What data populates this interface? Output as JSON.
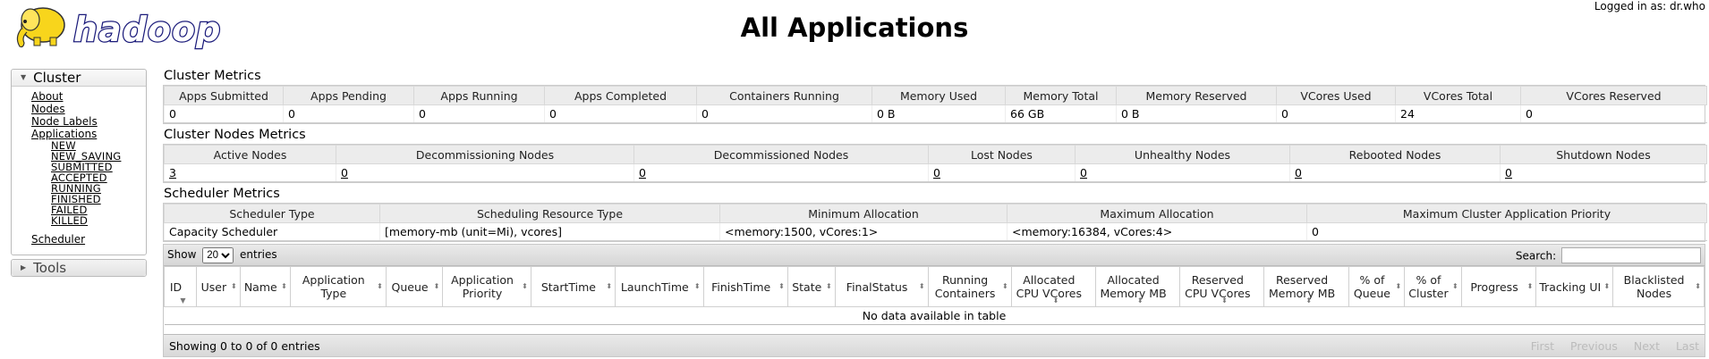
{
  "header": {
    "logo_text": "hadoop",
    "title": "All Applications",
    "login": "Logged in as: dr.who"
  },
  "nav": {
    "cluster_label": "Cluster",
    "cluster_links": [
      "About",
      "Nodes",
      "Node Labels",
      "Applications"
    ],
    "app_states": [
      "NEW",
      "NEW_SAVING",
      "SUBMITTED",
      "ACCEPTED",
      "RUNNING",
      "FINISHED",
      "FAILED",
      "KILLED"
    ],
    "scheduler": "Scheduler",
    "tools_label": "Tools"
  },
  "cluster_metrics": {
    "title": "Cluster Metrics",
    "headers": [
      "Apps Submitted",
      "Apps Pending",
      "Apps Running",
      "Apps Completed",
      "Containers Running",
      "Memory Used",
      "Memory Total",
      "Memory Reserved",
      "VCores Used",
      "VCores Total",
      "VCores Reserved"
    ],
    "values": [
      "0",
      "0",
      "0",
      "0",
      "0",
      "0 B",
      "66 GB",
      "0 B",
      "0",
      "24",
      "0"
    ]
  },
  "nodes_metrics": {
    "title": "Cluster Nodes Metrics",
    "headers": [
      "Active Nodes",
      "Decommissioning Nodes",
      "Decommissioned Nodes",
      "Lost Nodes",
      "Unhealthy Nodes",
      "Rebooted Nodes",
      "Shutdown Nodes"
    ],
    "values": [
      "3",
      "0",
      "0",
      "0",
      "0",
      "0",
      "0"
    ]
  },
  "scheduler_metrics": {
    "title": "Scheduler Metrics",
    "headers": [
      "Scheduler Type",
      "Scheduling Resource Type",
      "Minimum Allocation",
      "Maximum Allocation",
      "Maximum Cluster Application Priority"
    ],
    "values": [
      "Capacity Scheduler",
      "[memory-mb (unit=Mi), vcores]",
      "<memory:1500, vCores:1>",
      "<memory:16384, vCores:4>",
      "0"
    ]
  },
  "apps_table": {
    "show_label": "Show",
    "entries_value": "20",
    "entries_label": "entries",
    "search_label": "Search:",
    "columns": [
      "ID",
      "User",
      "Name",
      "Application Type",
      "Queue",
      "Application Priority",
      "StartTime",
      "LaunchTime",
      "FinishTime",
      "State",
      "FinalStatus",
      "Running Containers",
      "Allocated CPU VCores",
      "Allocated Memory MB",
      "Reserved CPU VCores",
      "Reserved Memory MB",
      "% of Queue",
      "% of Cluster",
      "Progress",
      "Tracking UI",
      "Blacklisted Nodes"
    ],
    "empty_message": "No data available in table",
    "info": "Showing 0 to 0 of 0 entries",
    "pager": [
      "First",
      "Previous",
      "Next",
      "Last"
    ]
  }
}
